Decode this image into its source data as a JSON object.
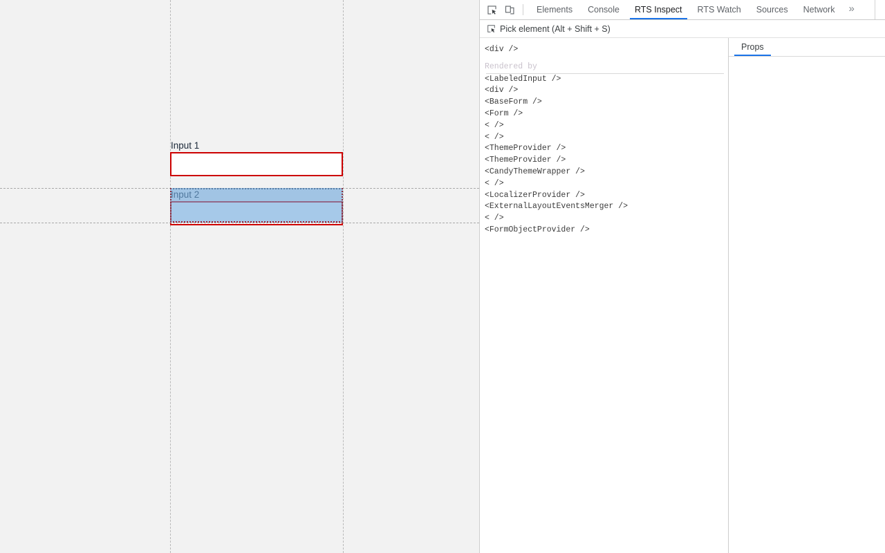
{
  "page": {
    "background_color": "#f2f2f2",
    "form": {
      "fields": [
        {
          "label": "Input 1",
          "value": "",
          "placeholder": "",
          "border_color": "#cc0000",
          "state": "error"
        },
        {
          "label": "Input 2",
          "value": "",
          "placeholder": "",
          "border_color": "#cc0000",
          "state": "error-highlighted"
        }
      ]
    },
    "inspect_overlay": {
      "color": "#a8cedb",
      "target_field_label": "Input 2"
    }
  },
  "devtools": {
    "toolbar": {
      "inspect_icon": "inspect-element-icon",
      "device_icon": "device-toolbar-icon",
      "more_tabs_label": "»",
      "tabs": [
        {
          "label": "Elements",
          "active": false
        },
        {
          "label": "Console",
          "active": false
        },
        {
          "label": "RTS Inspect",
          "active": true
        },
        {
          "label": "RTS Watch",
          "active": false
        },
        {
          "label": "Sources",
          "active": false
        },
        {
          "label": "Network",
          "active": false
        }
      ]
    },
    "pickbar": {
      "icon": "pick-element-icon",
      "label": "Pick element (Alt + Shift + S)"
    },
    "tree": {
      "selected_node": "<div />",
      "section_title": "Rendered by",
      "ancestors": [
        "<LabeledInput />",
        "<div />",
        "<BaseForm />",
        "<Form />",
        "< />",
        "< />",
        "<ThemeProvider />",
        "<ThemeProvider />",
        "<CandyThemeWrapper />",
        "< />",
        "<LocalizerProvider />",
        "<ExternalLayoutEventsMerger />",
        "< />",
        "<FormObjectProvider />"
      ]
    },
    "sidebar": {
      "tabs": [
        {
          "label": "Props",
          "active": true
        }
      ],
      "content": ""
    }
  },
  "theme": {
    "accent": "#1a73e8",
    "error": "#cc0000",
    "highlight": "#6fa8dc",
    "text": "#3c4043",
    "muted": "#c9c2cc"
  }
}
